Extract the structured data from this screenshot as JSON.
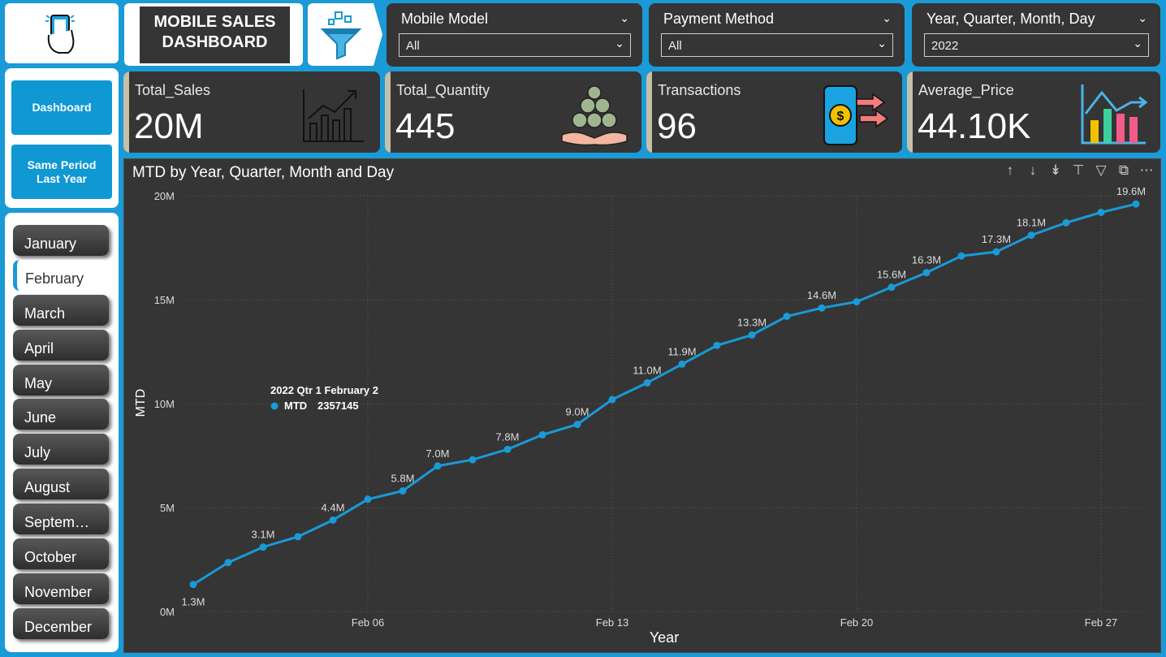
{
  "header": {
    "title_line1": "MOBILE SALES",
    "title_line2": "DASHBOARD"
  },
  "slicers": [
    {
      "title": "Mobile Model",
      "value": "All"
    },
    {
      "title": "Payment Method",
      "value": "All"
    },
    {
      "title": "Year, Quarter, Month, Day",
      "value": "2022"
    }
  ],
  "nav": {
    "dashboard": "Dashboard",
    "same_period_line1": "Same Period",
    "same_period_line2": "Last Year"
  },
  "months": [
    "January",
    "February",
    "March",
    "April",
    "May",
    "June",
    "July",
    "August",
    "Septem…",
    "October",
    "November",
    "December"
  ],
  "active_month": "February",
  "kpis": [
    {
      "label": "Total_Sales",
      "value": "20M"
    },
    {
      "label": "Total_Quantity",
      "value": "445"
    },
    {
      "label": "Transactions",
      "value": "96"
    },
    {
      "label": "Average_Price",
      "value": "44.10K"
    }
  ],
  "chart": {
    "title": "MTD by Year, Quarter, Month and Day",
    "tooltip_title": "2022 Qtr 1 February 2",
    "tooltip_series": "MTD",
    "tooltip_value": "2357145"
  },
  "colors": {
    "line": "#1a9ad6",
    "card": "#353535",
    "background": "#1a9ad6"
  },
  "chart_data": {
    "type": "line",
    "title": "MTD by Year, Quarter, Month and Day",
    "xlabel": "Year",
    "ylabel": "MTD",
    "ylim": [
      0,
      20000000
    ],
    "yticks": [
      "0M",
      "5M",
      "10M",
      "15M",
      "20M"
    ],
    "xticks": [
      "Feb 06",
      "Feb 13",
      "Feb 20",
      "Feb 27"
    ],
    "x": [
      "Feb 01",
      "Feb 02",
      "Feb 03",
      "Feb 04",
      "Feb 05",
      "Feb 06",
      "Feb 07",
      "Feb 08",
      "Feb 09",
      "Feb 10",
      "Feb 11",
      "Feb 12",
      "Feb 13",
      "Feb 14",
      "Feb 15",
      "Feb 16",
      "Feb 17",
      "Feb 18",
      "Feb 19",
      "Feb 20",
      "Feb 21",
      "Feb 22",
      "Feb 23",
      "Feb 24",
      "Feb 25",
      "Feb 26",
      "Feb 27",
      "Feb 28"
    ],
    "series": [
      {
        "name": "MTD",
        "values": [
          1.3,
          2.357145,
          3.1,
          3.6,
          4.4,
          5.4,
          5.8,
          7.0,
          7.3,
          7.8,
          8.5,
          9.0,
          10.2,
          11.0,
          11.9,
          12.8,
          13.3,
          14.2,
          14.6,
          14.9,
          15.6,
          16.3,
          17.1,
          17.3,
          18.1,
          18.7,
          19.2,
          19.6
        ],
        "value_unit": "M",
        "labels": {
          "0": "1.3M",
          "2": "3.1M",
          "4": "4.4M",
          "6": "5.8M",
          "7": "7.0M",
          "9": "7.8M",
          "11": "9.0M",
          "13": "11.0M",
          "14": "11.9M",
          "16": "13.3M",
          "18": "14.6M",
          "20": "15.6M",
          "21": "16.3M",
          "23": "17.3M",
          "24": "18.1M",
          "27": "19.6M"
        }
      }
    ],
    "grid": true,
    "legend": "none"
  }
}
